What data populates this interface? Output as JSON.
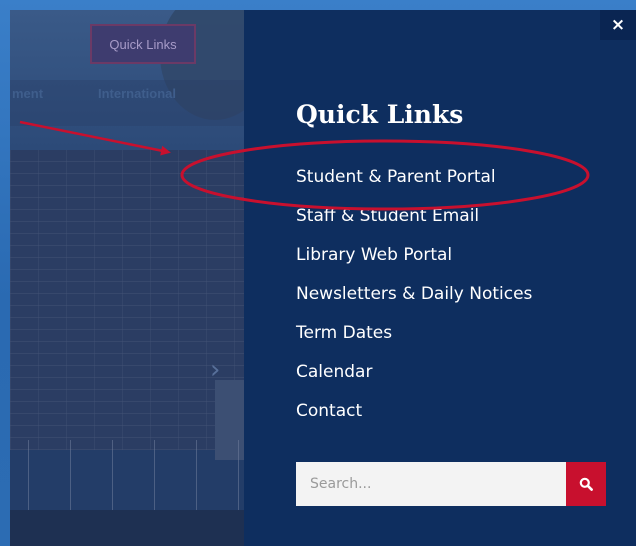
{
  "site": {
    "quick_links_button": "Quick Links",
    "nav_items": [
      "ment",
      "International"
    ]
  },
  "panel": {
    "close_label": "×",
    "title": "Quick Links",
    "links": [
      "Student & Parent Portal",
      "Staff & Student Email",
      "Library Web Portal",
      "Newsletters & Daily Notices",
      "Term Dates",
      "Calendar",
      "Contact"
    ],
    "search": {
      "placeholder": "Search...",
      "button_icon": "search-icon"
    }
  },
  "annotation": {
    "highlighted_item": "Student & Parent Portal",
    "color": "#c8102e"
  },
  "colors": {
    "panel_bg": "#0e2e5f",
    "accent_red": "#c8102e",
    "frame_blue": "#2b6cb5"
  }
}
